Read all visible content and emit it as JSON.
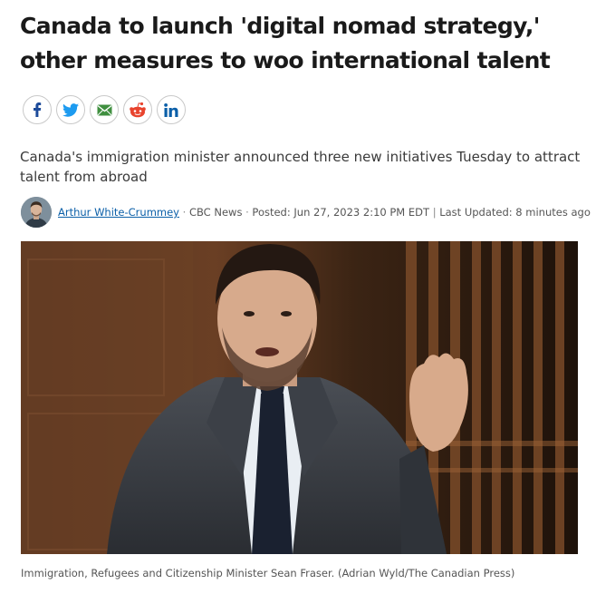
{
  "article": {
    "headline": "Canada to launch 'digital nomad strategy,' other measures to woo international talent",
    "deck": "Canada's immigration minister announced three new initiatives Tuesday to attract talent from abroad",
    "byline": {
      "author": "Arthur White-Crummey",
      "source": "CBC News",
      "posted": "Posted: Jun 27, 2023 2:10 PM EDT",
      "updated": "Last Updated: 8 minutes ago"
    },
    "photo_caption": "Immigration, Refugees and Citizenship Minister Sean Fraser. (Adrian Wyld/The Canadian Press)"
  },
  "share_buttons": [
    {
      "icon": "facebook-icon",
      "color": "#1d4b9a"
    },
    {
      "icon": "twitter-icon",
      "color": "#1d9bf0"
    },
    {
      "icon": "email-icon",
      "color": "#3f8f3f"
    },
    {
      "icon": "reddit-icon",
      "color": "#e8432d"
    },
    {
      "icon": "linkedin-icon",
      "color": "#0b5fa8"
    }
  ],
  "separators": {
    "dot": "·",
    "pipe": "|"
  }
}
